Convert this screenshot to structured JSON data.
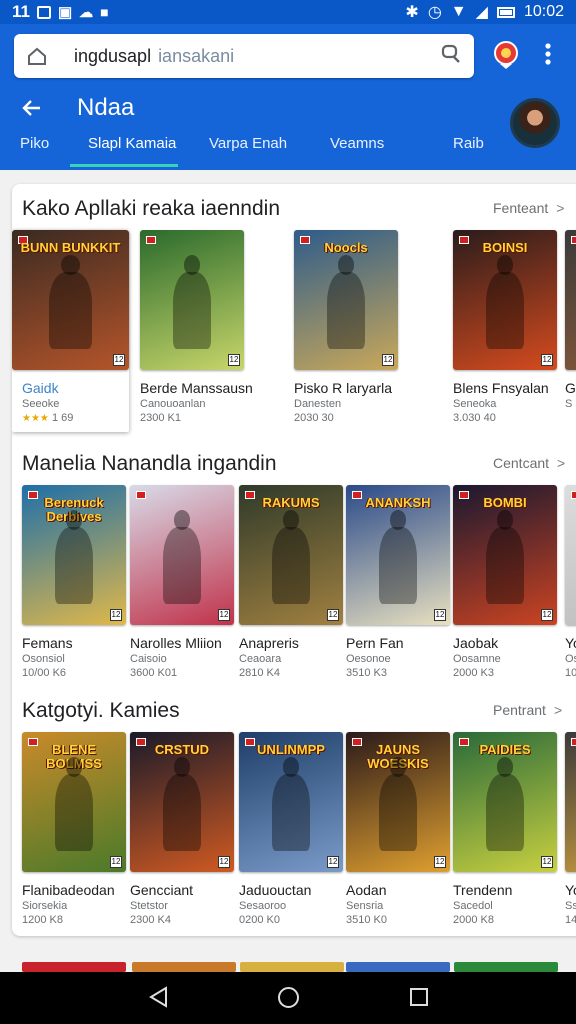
{
  "status": {
    "time_left": "11",
    "time_right": "10:02"
  },
  "header": {
    "search_query": "ingdusapl",
    "search_placeholder": "iansakani",
    "title": "Ndaa",
    "tabs": [
      {
        "label": "Piko"
      },
      {
        "label": "Slapl Kamaia"
      },
      {
        "label": "Varpa Enah"
      },
      {
        "label": "Veamns"
      },
      {
        "label": "Raib"
      }
    ],
    "active_tab": "Slapl Kamaia"
  },
  "sections": [
    {
      "title": "Kako Apllaki reaka iaenndin",
      "link": "Fenteant",
      "items": [
        {
          "name": "Gaidk",
          "sub": "Seeoke",
          "size": "1 69",
          "stars": "★★★",
          "logo": "BUNN BUNKKIT",
          "colors": [
            "#3a2a22",
            "#b5552a"
          ],
          "focused": true
        },
        {
          "name": "Berde Manssausn",
          "sub": "Canouoanlan",
          "size": "2300 K1",
          "logo": "",
          "colors": [
            "#2a6a2c",
            "#c8d66a"
          ]
        },
        {
          "name": "Pisko R laryarla",
          "sub": "Danesten",
          "size": "2030 30",
          "logo": "Noocls",
          "colors": [
            "#2e5c8a",
            "#c9a85a"
          ]
        },
        {
          "name": "Blens Fnsyalan",
          "sub": "Seneoka",
          "size": "3.030 40",
          "logo": "BOINSI",
          "colors": [
            "#2a1c1c",
            "#d64b1e"
          ]
        },
        {
          "name": "G",
          "sub": "S",
          "size": "",
          "logo": "",
          "colors": [
            "#3a3a3a",
            "#8a5a3a"
          ]
        }
      ]
    },
    {
      "title": "Manelia Nanandla ingandin",
      "link": "Centcant",
      "items": [
        {
          "name": "Femans",
          "sub": "Osonsiol",
          "size": "10/00 K6",
          "logo": "Berenuck Derbives",
          "colors": [
            "#1f6fa8",
            "#e0b84a"
          ]
        },
        {
          "name": "Narolles Mliion",
          "sub": "Caisoio",
          "size": "3600 K01",
          "logo": "",
          "colors": [
            "#d8dbe8",
            "#c0324a"
          ]
        },
        {
          "name": "Anapreris",
          "sub": "Ceaoara",
          "size": "2810 K4",
          "logo": "RAKUMS",
          "colors": [
            "#2f3a2a",
            "#a08040"
          ]
        },
        {
          "name": "Pern Fan",
          "sub": "Oesonoe",
          "size": "3510 K3",
          "logo": "ANANKSH",
          "colors": [
            "#2a4a8a",
            "#e8e0c0"
          ]
        },
        {
          "name": "Jaobak",
          "sub": "Oosamne",
          "size": "2000 K3",
          "logo": "BOMBI",
          "colors": [
            "#1a1830",
            "#cc4422"
          ]
        },
        {
          "name": "Yo",
          "sub": "Os",
          "size": "10",
          "logo": "",
          "colors": [
            "#dddddd",
            "#bbbbbb"
          ]
        }
      ]
    },
    {
      "title": "Katgotyi. Kamies",
      "link": "Pentrant",
      "items": [
        {
          "name": "Flanibadeodan",
          "sub": "Siorsekia",
          "size": "1200 K8",
          "logo": "BLENE BOLMSS",
          "colors": [
            "#c98a2a",
            "#4a7a2a"
          ]
        },
        {
          "name": "Gencciant",
          "sub": "Stetstor",
          "size": "2300 K4",
          "logo": "CRSTUD",
          "colors": [
            "#1a1a2a",
            "#d05a22"
          ]
        },
        {
          "name": "Jaduouctan",
          "sub": "Sesaoroo",
          "size": "0200 K0",
          "logo": "UNLINMPP",
          "colors": [
            "#1f3f6a",
            "#7a9ac8"
          ]
        },
        {
          "name": "Aodan",
          "sub": "Sensria",
          "size": "3510 K0",
          "logo": "JAUNS WOESKIS",
          "colors": [
            "#2a1a1a",
            "#e0a030"
          ]
        },
        {
          "name": "Trendenn",
          "sub": "Sacedol",
          "size": "2000 K8",
          "logo": "PAIDIES",
          "colors": [
            "#2a6a3a",
            "#c8d040"
          ]
        },
        {
          "name": "Yo",
          "sub": "Ss",
          "size": "14",
          "logo": "",
          "colors": [
            "#3a3a3a",
            "#d0a040"
          ]
        }
      ]
    }
  ],
  "peek_colors": [
    "#c8222a",
    "#c87a2a",
    "#d8b040",
    "#3a6ac0",
    "#2a8a3a"
  ],
  "accent": "#1565d8",
  "tab_indicator": "#38d2b8"
}
